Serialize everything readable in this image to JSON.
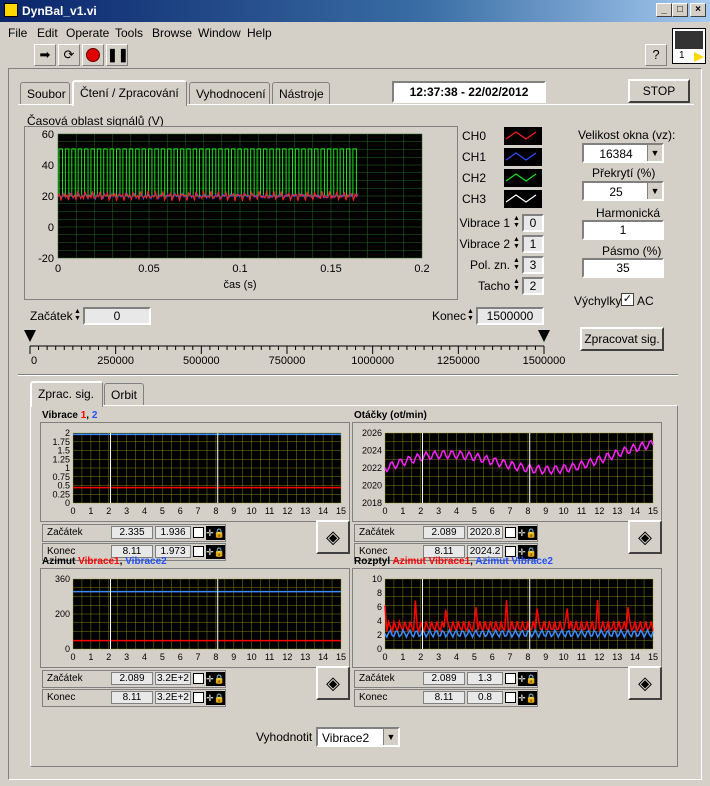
{
  "window": {
    "title": "DynBal_v1.vi"
  },
  "menu": [
    "File",
    "Edit",
    "Operate",
    "Tools",
    "Browse",
    "Window",
    "Help"
  ],
  "toolbar": {
    "run_icon": "arrow-right-icon",
    "loop_icon": "run-continuous-icon",
    "abort_icon": "abort-icon",
    "pause_icon": "pause-icon",
    "help_icon": "help-icon",
    "connector_label": "1"
  },
  "tabs": [
    "Soubor",
    "Čtení / Zpracování",
    "Vyhodnocení",
    "Nástroje"
  ],
  "active_tab": "Čtení / Zpracování",
  "datetime": "12:37:38 - 22/02/2012",
  "stop_label": "STOP",
  "signal_graph": {
    "title": "Časová oblast signálů (V)",
    "xlabel": "čas (s)",
    "yticks": [
      "60",
      "40",
      "20",
      "0",
      "-20"
    ],
    "xticks": [
      "0",
      "0.05",
      "0.1",
      "0.15",
      "0.2"
    ]
  },
  "channels": [
    "CH0",
    "CH1",
    "CH2",
    "CH3"
  ],
  "channel_colors": [
    "#ff2020",
    "#3050ff",
    "#20e020",
    "#ffffff"
  ],
  "channel_map": [
    {
      "label": "Vibrace 1",
      "value": "0"
    },
    {
      "label": "Vibrace 2",
      "value": "1"
    },
    {
      "label": "Pol. zn.",
      "value": "3"
    },
    {
      "label": "Tacho",
      "value": "2"
    }
  ],
  "settings": {
    "window_label": "Velikost okna (vz):",
    "window_value": "16384",
    "overlap_label": "Překrytí (%)",
    "overlap_value": "25",
    "harm_label": "Harmonická",
    "harm_value": "1",
    "band_label": "Pásmo (%)",
    "band_value": "35",
    "ac_label": "Výchylky",
    "ac_check": "AC",
    "process_btn": "Zpracovat sig."
  },
  "range": {
    "start_label": "Začátek",
    "start_value": "0",
    "end_label": "Konec",
    "end_value": "1500000",
    "ticks": [
      "0",
      "250000",
      "500000",
      "750000",
      "1000000",
      "1250000",
      "1500000"
    ]
  },
  "subtabs": [
    "Zprac. sig.",
    "Orbit"
  ],
  "plots": [
    {
      "title": "Vibrace 1, 2",
      "title_parts": [
        [
          "Vibrace ",
          "#000"
        ],
        [
          "1",
          "#ff0000"
        ],
        [
          ", ",
          "#000"
        ],
        [
          "2",
          "#2050ff"
        ]
      ],
      "yticks": [
        "2",
        "1.75",
        "1.5",
        "1.25",
        "1",
        "0.75",
        "0.5",
        "0.25",
        "0"
      ],
      "cursors": [
        {
          "label": "Začátek",
          "x": "2.335",
          "y": "1.936"
        },
        {
          "label": "Konec",
          "x": "8.11",
          "y": "1.973"
        }
      ]
    },
    {
      "title": "Otáčky (ot/min)",
      "title_parts": [
        [
          "Otáčky (ot/min)",
          "#000"
        ]
      ],
      "yticks": [
        "2026",
        "2024",
        "2022",
        "2020",
        "2018"
      ],
      "cursors": [
        {
          "label": "Začátek",
          "x": "2.089",
          "y": "2020.8"
        },
        {
          "label": "Konec",
          "x": "8.11",
          "y": "2024.2"
        }
      ]
    },
    {
      "title": "Azimut Vibrace1, Vibrace2",
      "title_parts": [
        [
          "Azimut ",
          "#000"
        ],
        [
          "Vibrace1",
          "#ff0000"
        ],
        [
          ", ",
          "#000"
        ],
        [
          "Vibrace2",
          "#2050ff"
        ]
      ],
      "yticks": [
        "360",
        "",
        "200",
        "",
        "0"
      ],
      "cursors": [
        {
          "label": "Začátek",
          "x": "2.089",
          "y": "3.2E+2"
        },
        {
          "label": "Konec",
          "x": "8.11",
          "y": "3.2E+2"
        }
      ]
    },
    {
      "title": "Rozptyl Azimut Vibrace1, Azimut Vibrace2",
      "title_parts": [
        [
          "Rozptyl ",
          "#000"
        ],
        [
          "Azimut Vibrace1",
          "#ff0000"
        ],
        [
          ", ",
          "#000"
        ],
        [
          "Azimut Vibrace2",
          "#2050ff"
        ]
      ],
      "yticks": [
        "10",
        "8",
        "6",
        "4",
        "2",
        "0"
      ],
      "cursors": [
        {
          "label": "Začátek",
          "x": "2.089",
          "y": "1.3"
        },
        {
          "label": "Konec",
          "x": "8.11",
          "y": "0.8"
        }
      ]
    }
  ],
  "plot_xticks": [
    "0",
    "1",
    "2",
    "3",
    "4",
    "5",
    "6",
    "7",
    "8",
    "9",
    "10",
    "11",
    "12",
    "13",
    "14",
    "15"
  ],
  "evaluate": {
    "label": "Vyhodnotit z:",
    "value": "Vibrace2"
  }
}
